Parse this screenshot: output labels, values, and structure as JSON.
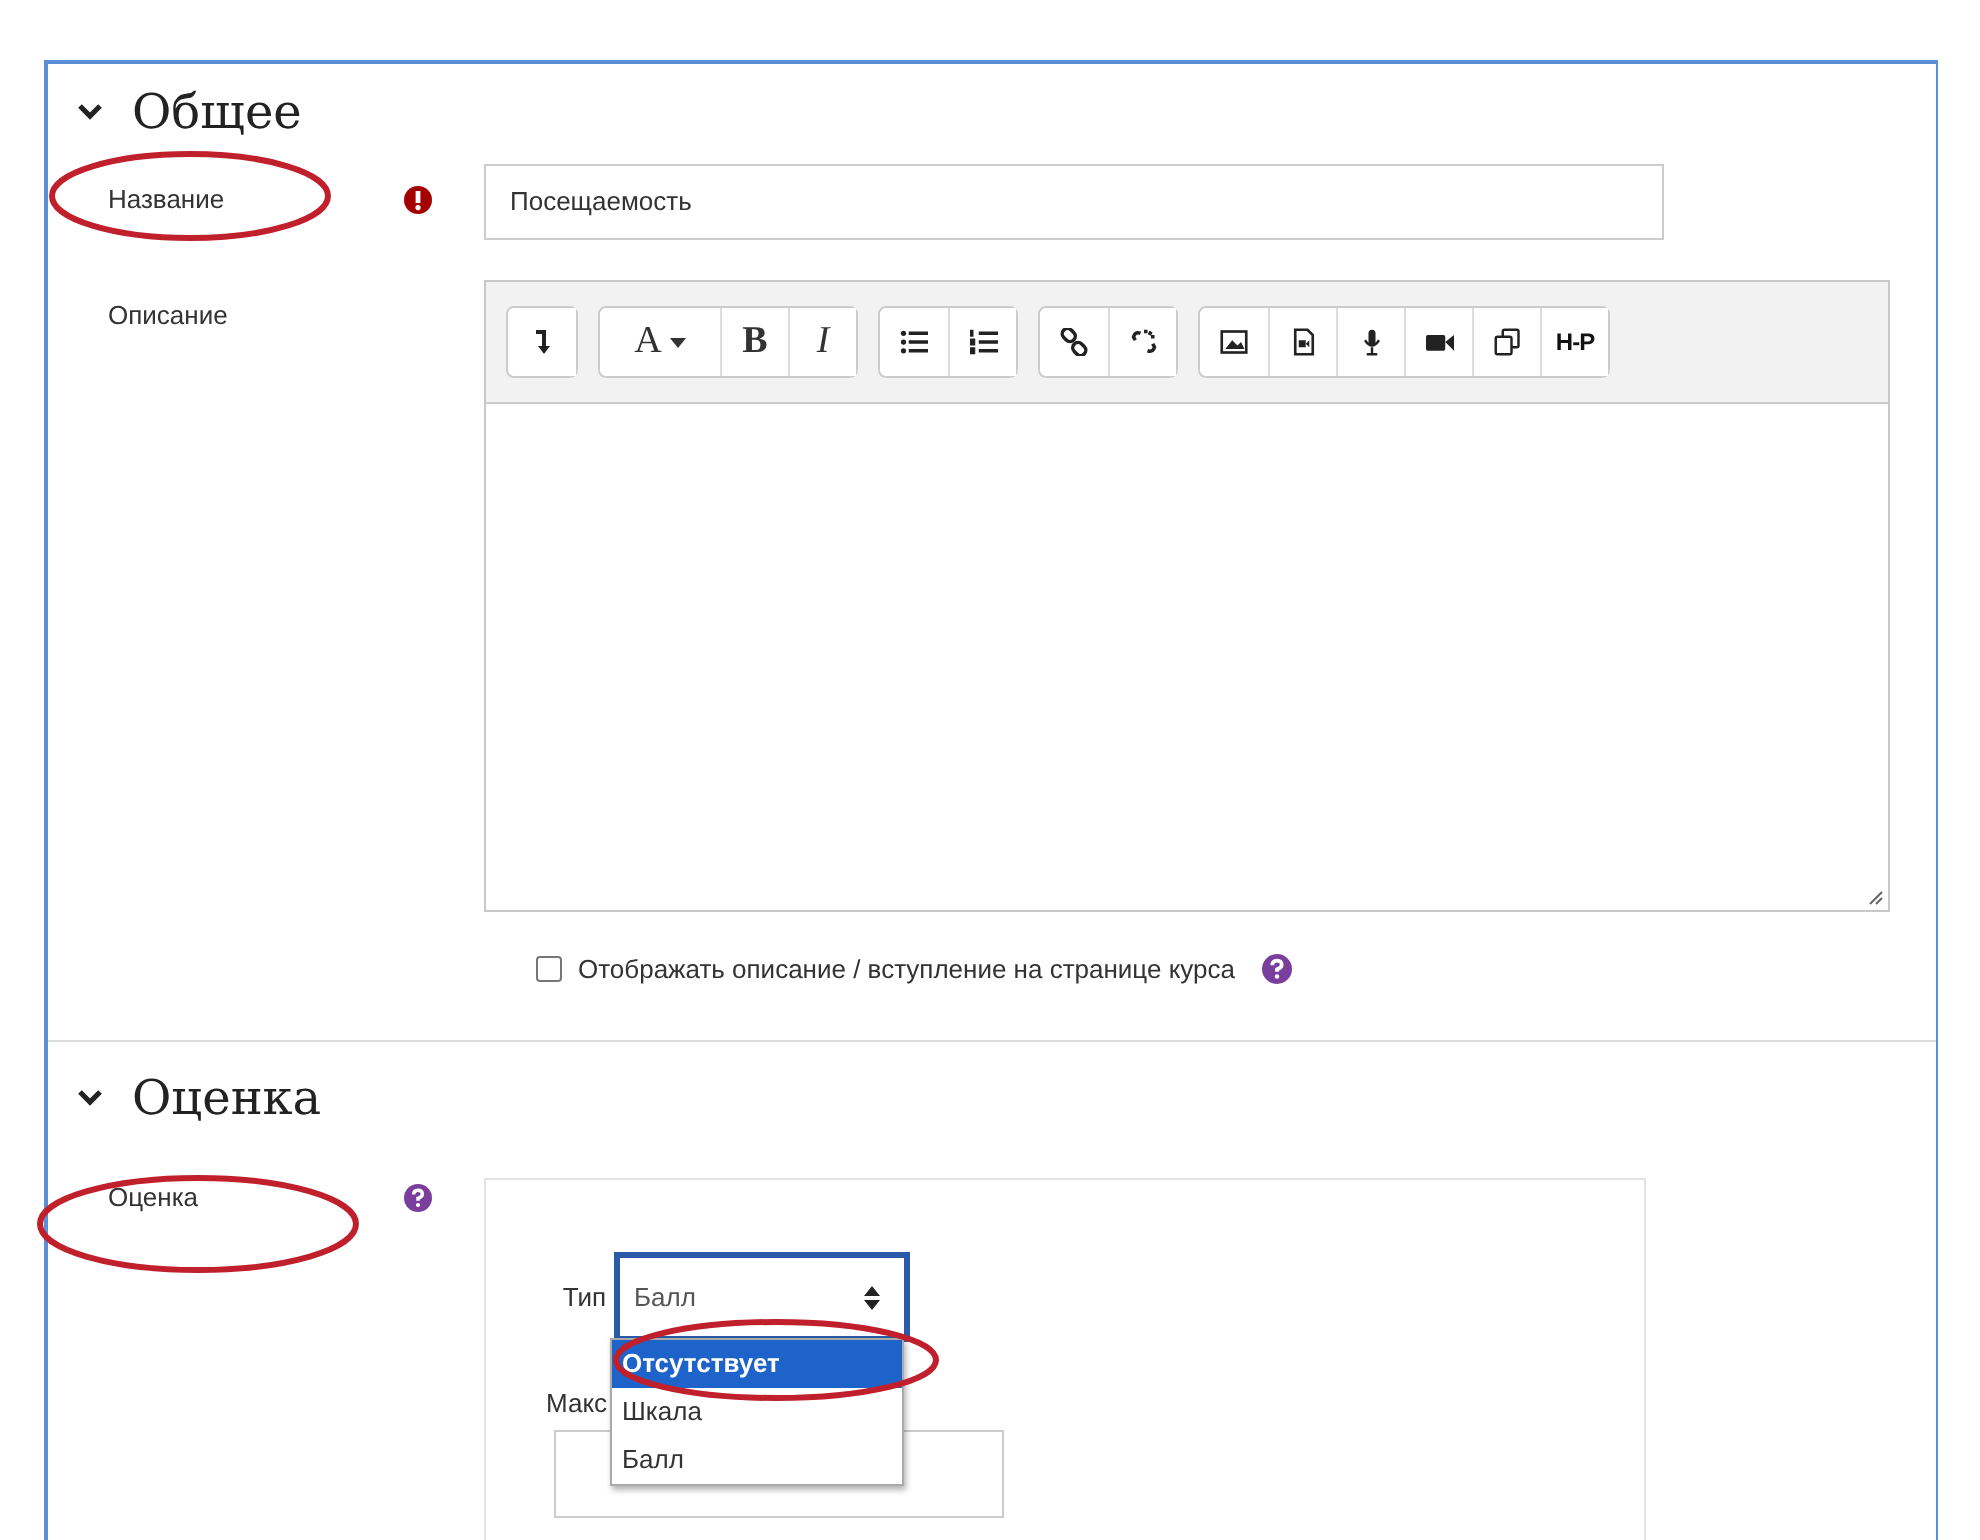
{
  "sections": [
    {
      "title": "Общее",
      "expanded": true
    },
    {
      "title": "Оценка",
      "expanded": true
    }
  ],
  "name_field": {
    "label": "Название",
    "value": "Посещаемость"
  },
  "description": {
    "label": "Описание",
    "toolbar": [
      [
        {
          "kind": "undo"
        }
      ],
      [
        {
          "kind": "textmenu",
          "label": "A"
        },
        {
          "kind": "bold",
          "label": "B"
        },
        {
          "kind": "italic",
          "label": "I"
        }
      ],
      [
        {
          "kind": "ul"
        },
        {
          "kind": "ol"
        }
      ],
      [
        {
          "kind": "link"
        },
        {
          "kind": "unlink"
        }
      ],
      [
        {
          "kind": "image"
        },
        {
          "kind": "media"
        },
        {
          "kind": "mic"
        },
        {
          "kind": "video"
        },
        {
          "kind": "copy"
        },
        {
          "kind": "h5p",
          "label": "H-P"
        }
      ]
    ]
  },
  "show_description": {
    "label": "Отображать описание / вступление на странице курса",
    "checked": false
  },
  "grade": {
    "label": "Оценка",
    "type_label": "Тип",
    "type_value": "Балл",
    "max_label": "Макс",
    "options": [
      {
        "label": "Отсутствует",
        "selected": true
      },
      {
        "label": "Шкала",
        "selected": false
      },
      {
        "label": "Балл",
        "selected": false
      }
    ]
  }
}
